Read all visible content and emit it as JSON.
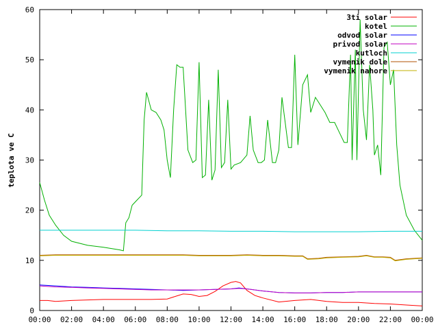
{
  "chart_data": {
    "type": "line",
    "ylabel": "teplota ve C",
    "xlabel": "",
    "xlim": [
      0,
      24
    ],
    "ylim": [
      0,
      60
    ],
    "x_ticks": [
      {
        "value": 0,
        "label": "00:00"
      },
      {
        "value": 2,
        "label": "02:00"
      },
      {
        "value": 4,
        "label": "04:00"
      },
      {
        "value": 6,
        "label": "06:00"
      },
      {
        "value": 8,
        "label": "08:00"
      },
      {
        "value": 10,
        "label": "10:00"
      },
      {
        "value": 12,
        "label": "12:00"
      },
      {
        "value": 14,
        "label": "14:00"
      },
      {
        "value": 16,
        "label": "16:00"
      },
      {
        "value": 18,
        "label": "18:00"
      },
      {
        "value": 20,
        "label": "20:00"
      },
      {
        "value": 22,
        "label": "22:00"
      },
      {
        "value": 24,
        "label": "00:00"
      }
    ],
    "y_ticks": [
      {
        "value": 0,
        "label": "0"
      },
      {
        "value": 10,
        "label": "10"
      },
      {
        "value": 20,
        "label": "20"
      },
      {
        "value": 30,
        "label": "30"
      },
      {
        "value": 40,
        "label": "40"
      },
      {
        "value": 50,
        "label": "50"
      },
      {
        "value": 60,
        "label": "60"
      }
    ],
    "legend_position": "top-right",
    "grid": false,
    "series": [
      {
        "name": "3ti solar",
        "color": "#ff0000",
        "x": [
          0,
          0.5,
          1,
          2,
          3,
          4,
          5,
          6,
          7,
          8,
          8.5,
          9,
          9.5,
          10,
          10.5,
          11,
          11.5,
          12,
          12.3,
          12.6,
          13,
          13.5,
          14,
          15,
          16,
          17,
          18,
          19,
          20,
          21,
          22,
          23,
          24
        ],
        "y": [
          2,
          2,
          1.8,
          2,
          2.1,
          2.2,
          2.2,
          2.2,
          2.2,
          2.3,
          2.8,
          3.3,
          3.2,
          2.8,
          3.0,
          3.8,
          4.9,
          5.6,
          5.8,
          5.5,
          4.0,
          3.0,
          2.5,
          1.7,
          2.0,
          2.2,
          1.8,
          1.6,
          1.6,
          1.4,
          1.3,
          1.1,
          0.9
        ]
      },
      {
        "name": "kotel",
        "color": "#00b000",
        "x": [
          0,
          0.3,
          0.6,
          1,
          1.5,
          2,
          3,
          4,
          5,
          5.25,
          5.4,
          5.6,
          5.8,
          6.1,
          6.4,
          6.55,
          6.7,
          7.0,
          7.3,
          7.6,
          7.8,
          8.0,
          8.2,
          8.4,
          8.6,
          8.8,
          9.0,
          9.3,
          9.6,
          9.8,
          10.0,
          10.2,
          10.4,
          10.6,
          10.8,
          11.0,
          11.2,
          11.4,
          11.6,
          11.8,
          12.0,
          12.2,
          12.6,
          13.0,
          13.2,
          13.4,
          13.7,
          13.9,
          14.1,
          14.3,
          14.6,
          14.8,
          15.0,
          15.2,
          15.6,
          15.8,
          16.0,
          16.2,
          16.5,
          16.8,
          17.0,
          17.3,
          17.6,
          17.9,
          18.2,
          18.5,
          18.8,
          19.1,
          19.3,
          19.5,
          19.6,
          19.8,
          19.9,
          20.1,
          20.3,
          20.5,
          20.7,
          20.9,
          21.0,
          21.2,
          21.4,
          21.6,
          21.8,
          22.0,
          22.2,
          22.4,
          22.6,
          23.0,
          23.5,
          24.0
        ],
        "y": [
          25.5,
          22,
          19,
          17,
          15,
          13.8,
          13,
          12.6,
          12.1,
          11.9,
          17.5,
          18.5,
          21,
          22,
          23,
          38,
          43.5,
          40,
          39.5,
          38,
          36,
          30,
          26.5,
          40,
          49,
          48.5,
          48.5,
          32,
          29.5,
          30,
          49.5,
          26.5,
          27,
          42,
          26,
          28,
          48,
          28.5,
          29.5,
          42,
          28.2,
          29,
          29.5,
          31,
          38.8,
          32,
          29.5,
          29.5,
          30,
          38,
          29.5,
          29.5,
          32,
          42.5,
          32.5,
          32.5,
          51,
          33,
          45,
          47,
          39.5,
          42.5,
          41,
          39.5,
          37.5,
          37.5,
          35.5,
          33.5,
          33.5,
          51,
          30,
          52,
          30,
          58,
          40,
          34,
          49,
          40,
          31,
          33,
          27,
          52.5,
          53.5,
          45,
          48,
          33,
          25,
          19,
          16,
          14
        ]
      },
      {
        "name": "odvod solar",
        "color": "#0000ff",
        "x": [
          0,
          1,
          2,
          3,
          4,
          5,
          6,
          7,
          8,
          9,
          10,
          11,
          12,
          12.5,
          13,
          14,
          15,
          16,
          17,
          18,
          19,
          20,
          21,
          22,
          23,
          24
        ],
        "y": [
          5.1,
          4.9,
          4.7,
          4.6,
          4.5,
          4.4,
          4.3,
          4.2,
          4.1,
          4.0,
          4.1,
          4.2,
          4.3,
          4.5,
          4.3,
          3.9,
          3.6,
          3.5,
          3.5,
          3.6,
          3.6,
          3.7,
          3.7,
          3.7,
          3.7,
          3.7
        ]
      },
      {
        "name": "privod solar",
        "color": "#c000c0",
        "x": [
          0,
          1,
          2,
          3,
          4,
          5,
          6,
          7,
          8,
          9,
          10,
          11,
          12,
          12.5,
          13,
          14,
          15,
          16,
          17,
          18,
          19,
          20,
          21,
          22,
          23,
          24
        ],
        "y": [
          4.9,
          4.7,
          4.6,
          4.5,
          4.4,
          4.3,
          4.2,
          4.1,
          4.1,
          4.1,
          4.1,
          4.2,
          4.3,
          4.4,
          4.3,
          3.9,
          3.6,
          3.5,
          3.5,
          3.6,
          3.6,
          3.7,
          3.7,
          3.7,
          3.7,
          3.7
        ]
      },
      {
        "name": "kutloch",
        "color": "#00d0d0",
        "x": [
          0,
          2,
          4,
          6,
          8,
          10,
          12,
          14,
          16,
          18,
          20,
          22,
          24
        ],
        "y": [
          16.0,
          16.0,
          16.0,
          16.0,
          15.9,
          15.9,
          15.8,
          15.8,
          15.7,
          15.7,
          15.7,
          15.8,
          15.8
        ]
      },
      {
        "name": "vymenik dole",
        "color": "#b05000",
        "x": [
          0,
          1,
          2,
          3,
          4,
          5,
          6,
          7,
          8,
          9,
          10,
          11,
          12,
          13,
          14,
          15,
          16,
          16.5,
          16.8,
          17.5,
          18,
          19,
          20,
          20.5,
          21,
          21.5,
          22,
          22.3,
          23,
          24
        ],
        "y": [
          11.0,
          11.1,
          11.1,
          11.1,
          11.1,
          11.1,
          11.1,
          11.1,
          11.1,
          11.1,
          11.0,
          11.0,
          11.0,
          11.1,
          11.0,
          11.0,
          10.9,
          10.9,
          10.3,
          10.4,
          10.6,
          10.7,
          10.8,
          11.0,
          10.7,
          10.7,
          10.6,
          10.0,
          10.3,
          10.5
        ]
      },
      {
        "name": "vymenik nahore",
        "color": "#c0b000",
        "x": [
          0,
          1,
          2,
          3,
          4,
          5,
          6,
          7,
          8,
          9,
          10,
          11,
          12,
          13,
          14,
          15,
          16,
          16.5,
          16.8,
          17.5,
          18,
          19,
          20,
          20.5,
          21,
          21.5,
          22,
          22.3,
          23,
          24
        ],
        "y": [
          10.9,
          11.0,
          11.0,
          11.0,
          11.0,
          11.0,
          11.0,
          11.0,
          11.0,
          11.0,
          10.9,
          10.9,
          10.9,
          11.0,
          10.9,
          10.9,
          10.8,
          10.8,
          10.2,
          10.3,
          10.5,
          10.6,
          10.7,
          10.9,
          10.6,
          10.6,
          10.5,
          9.9,
          10.2,
          10.4
        ]
      }
    ]
  }
}
